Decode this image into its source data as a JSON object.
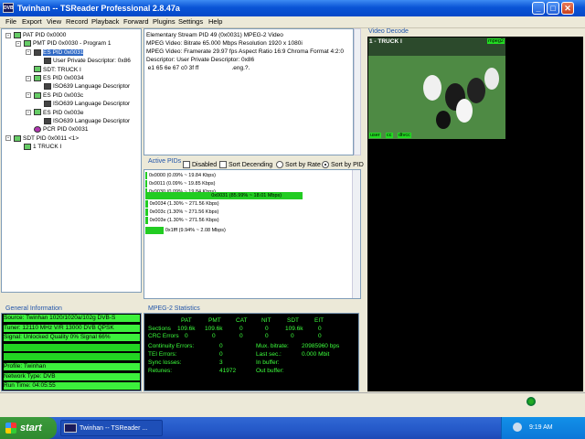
{
  "window": {
    "title": "Twinhan -- TSReader Professional 2.8.47a",
    "app_icon_text": "DVB"
  },
  "menu": [
    "File",
    "Export",
    "View",
    "Record",
    "Playback",
    "Forward",
    "Plugins",
    "Settings",
    "Help"
  ],
  "tree": [
    {
      "label": "PAT PID 0x0000",
      "indent": 0,
      "icon": "green",
      "pm": "-"
    },
    {
      "label": "PMT PID 0x0030 - Program 1",
      "indent": 1,
      "icon": "green",
      "pm": "-"
    },
    {
      "label": "ES PID 0x0031",
      "indent": 2,
      "icon": "dark",
      "pm": "-",
      "selected": true
    },
    {
      "label": "User Private Descriptor: 0x86",
      "indent": 3,
      "icon": "dark"
    },
    {
      "label": "SDT: TRUCK I",
      "indent": 2,
      "icon": "green"
    },
    {
      "label": "ES PID 0x0034",
      "indent": 2,
      "icon": "green",
      "pm": "-"
    },
    {
      "label": "ISO639 Language Descriptor",
      "indent": 3,
      "icon": "dark"
    },
    {
      "label": "ES PID 0x003c",
      "indent": 2,
      "icon": "green",
      "pm": "-"
    },
    {
      "label": "ISO639 Language Descriptor",
      "indent": 3,
      "icon": "dark"
    },
    {
      "label": "ES PID 0x003e",
      "indent": 2,
      "icon": "green",
      "pm": "-"
    },
    {
      "label": "ISO639 Language Descriptor",
      "indent": 3,
      "icon": "dark"
    },
    {
      "label": "PCR PID 0x0031",
      "indent": 2,
      "icon": "purple"
    },
    {
      "label": "SDT PID 0x0011 <1>",
      "indent": 0,
      "icon": "green",
      "pm": "-"
    },
    {
      "label": "1 TRUCK I",
      "indent": 1,
      "icon": "green"
    }
  ],
  "description": [
    "Elementary Stream PID 49 (0x0031) MPEG-2 Video",
    "MPEG Video: Bitrate 65.000 Mbps Resolution 1920 x 1080i",
    "MPEG Video: Framerate 29.97 fps Aspect Ratio 16:9 Chroma Format 4:2:0",
    "Descriptor: User Private Descriptor: 0x86",
    " e1 65 6e 67 c0 3f ff                    .eng.?."
  ],
  "active_pids": {
    "title": "Active PIDs",
    "options": {
      "disabled": "Disabled",
      "sort_descending": "Sort Decending",
      "sort_by_rate": "Sort by Rate",
      "sort_by_pid": "Sort by PID"
    },
    "rows": [
      {
        "label": "0x0000 (0.09% ~ 19.84 Kbps)",
        "pct": 0.09
      },
      {
        "label": "0x0011 (0.09% ~ 19.85 Kbps)",
        "pct": 0.09
      },
      {
        "label": "0x0030 (0.09% ~ 19.84 Kbps)",
        "pct": 0.09
      },
      {
        "label": "0x0031 (85.99% ~ 18.01 Mbps)",
        "pct": 85.99
      },
      {
        "label": "0x0034 (1.30% ~ 271.56 Kbps)",
        "pct": 1.3
      },
      {
        "label": "0x003c (1.30% ~ 271.56 Kbps)",
        "pct": 1.3
      },
      {
        "label": "0x003e (1.30% ~ 271.56 Kbps)",
        "pct": 1.3
      },
      {
        "label": "0x1fff (9.94% ~ 2.08 Mbps)",
        "pct": 9.94
      }
    ]
  },
  "general_info": {
    "title": "General Information",
    "lines": [
      {
        "text": "Source: Twinhan 1020/1020a/102g DVB-S",
        "color": "#3cf03c"
      },
      {
        "text": "Tuner: 12110 MHz V/R 13000 DVB QPSK",
        "color": "#3cf03c"
      },
      {
        "text": "Signal: Unlocked Quality 0% Signal 66%",
        "color": "#3cf03c"
      },
      {
        "text": "",
        "color": "#22d322"
      },
      {
        "text": "",
        "color": "#22d322"
      },
      {
        "text": "Profile: Twinhan",
        "color": "#3cf03c"
      },
      {
        "text": "Network Type: DVB",
        "color": "#3cf03c"
      },
      {
        "text": "Run Time: 04:05:55",
        "color": "#3cf03c"
      }
    ]
  },
  "mpeg2_stats": {
    "title": "MPEG-2 Statistics",
    "headers": [
      "PAT",
      "PMT",
      "CAT",
      "NIT",
      "SDT",
      "EIT"
    ],
    "sections_label": "Sections",
    "sections": [
      "109.6k",
      "109.6k",
      "0",
      "0",
      "109.6k",
      "0"
    ],
    "crc_label": "CRC Errors",
    "crc": [
      "0",
      "0",
      "0",
      "0",
      "0",
      "0"
    ],
    "continuity_label": "Continuity Errors:",
    "continuity": "0",
    "tei_label": "TEI Errors:",
    "tei": "0",
    "sync_label": "Sync losses:",
    "sync": "3",
    "retunes_label": "Retunes:",
    "retunes": "41972",
    "mux_label": "Mux. bitrate:",
    "mux": "20985960 bps",
    "last_sec_label": "Last sec.:",
    "last_sec": "0.000 Mbit",
    "in_buffer_label": "In buffer:",
    "out_buffer_label": "Out buffer:"
  },
  "video": {
    "title": "Video Decode",
    "overlay_channel": "1 - TRUCK I",
    "overlay_tag": "mpeg2",
    "overlay_bottom": [
      "user",
      "cc",
      "dtvcc"
    ]
  },
  "taskbar": {
    "start": "start",
    "task": "Twinhan -- TSReader ...",
    "clock": "9:19 AM"
  }
}
